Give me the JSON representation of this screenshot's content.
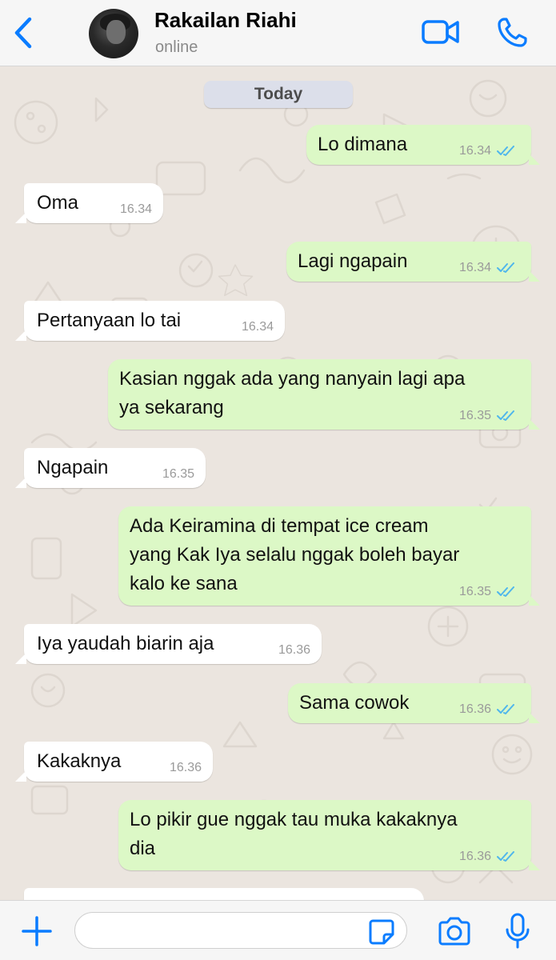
{
  "header": {
    "contact_name": "Rakailan Riahi",
    "status": "online",
    "accent_color": "#0a7cff"
  },
  "chat": {
    "date_label": "Today",
    "messages": [
      {
        "direction": "outgoing",
        "text": "Lo dimana",
        "time": "16.34",
        "read": true
      },
      {
        "direction": "incoming",
        "text": "Oma",
        "time": "16.34"
      },
      {
        "direction": "outgoing",
        "text": "Lagi ngapain",
        "time": "16.34",
        "read": true
      },
      {
        "direction": "incoming",
        "text": "Pertanyaan lo tai",
        "time": "16.34"
      },
      {
        "direction": "outgoing",
        "lines": [
          "Kasian nggak ada yang nanyain lagi apa",
          "ya sekarang"
        ],
        "time": "16.35",
        "read": true
      },
      {
        "direction": "incoming",
        "text": "Ngapain",
        "time": "16.35"
      },
      {
        "direction": "outgoing",
        "lines": [
          "Ada Keiramina di tempat ice cream",
          "yang Kak Iya selalu nggak boleh bayar",
          "kalo ke sana"
        ],
        "time": "16.35",
        "read": true
      },
      {
        "direction": "incoming",
        "text": "Iya yaudah biarin aja",
        "time": "16.36"
      },
      {
        "direction": "outgoing",
        "text": "Sama cowok",
        "time": "16.36",
        "read": true
      },
      {
        "direction": "incoming",
        "text": "Kakaknya",
        "time": "16.36"
      },
      {
        "direction": "outgoing",
        "lines": [
          "Lo pikir gue nggak tau muka kakaknya",
          "dia"
        ],
        "time": "16.36",
        "read": true
      }
    ],
    "outgoing_bubble_color": "#dcf8c6",
    "incoming_bubble_color": "#ffffff",
    "read_tick_color": "#4fb6ec"
  },
  "input": {
    "placeholder": "",
    "value": ""
  },
  "icons": {
    "back": "chevron-left-icon",
    "video": "video-camera-icon",
    "call": "phone-icon",
    "plus": "plus-icon",
    "sticker": "sticker-icon",
    "camera": "camera-icon",
    "mic": "microphone-icon"
  }
}
